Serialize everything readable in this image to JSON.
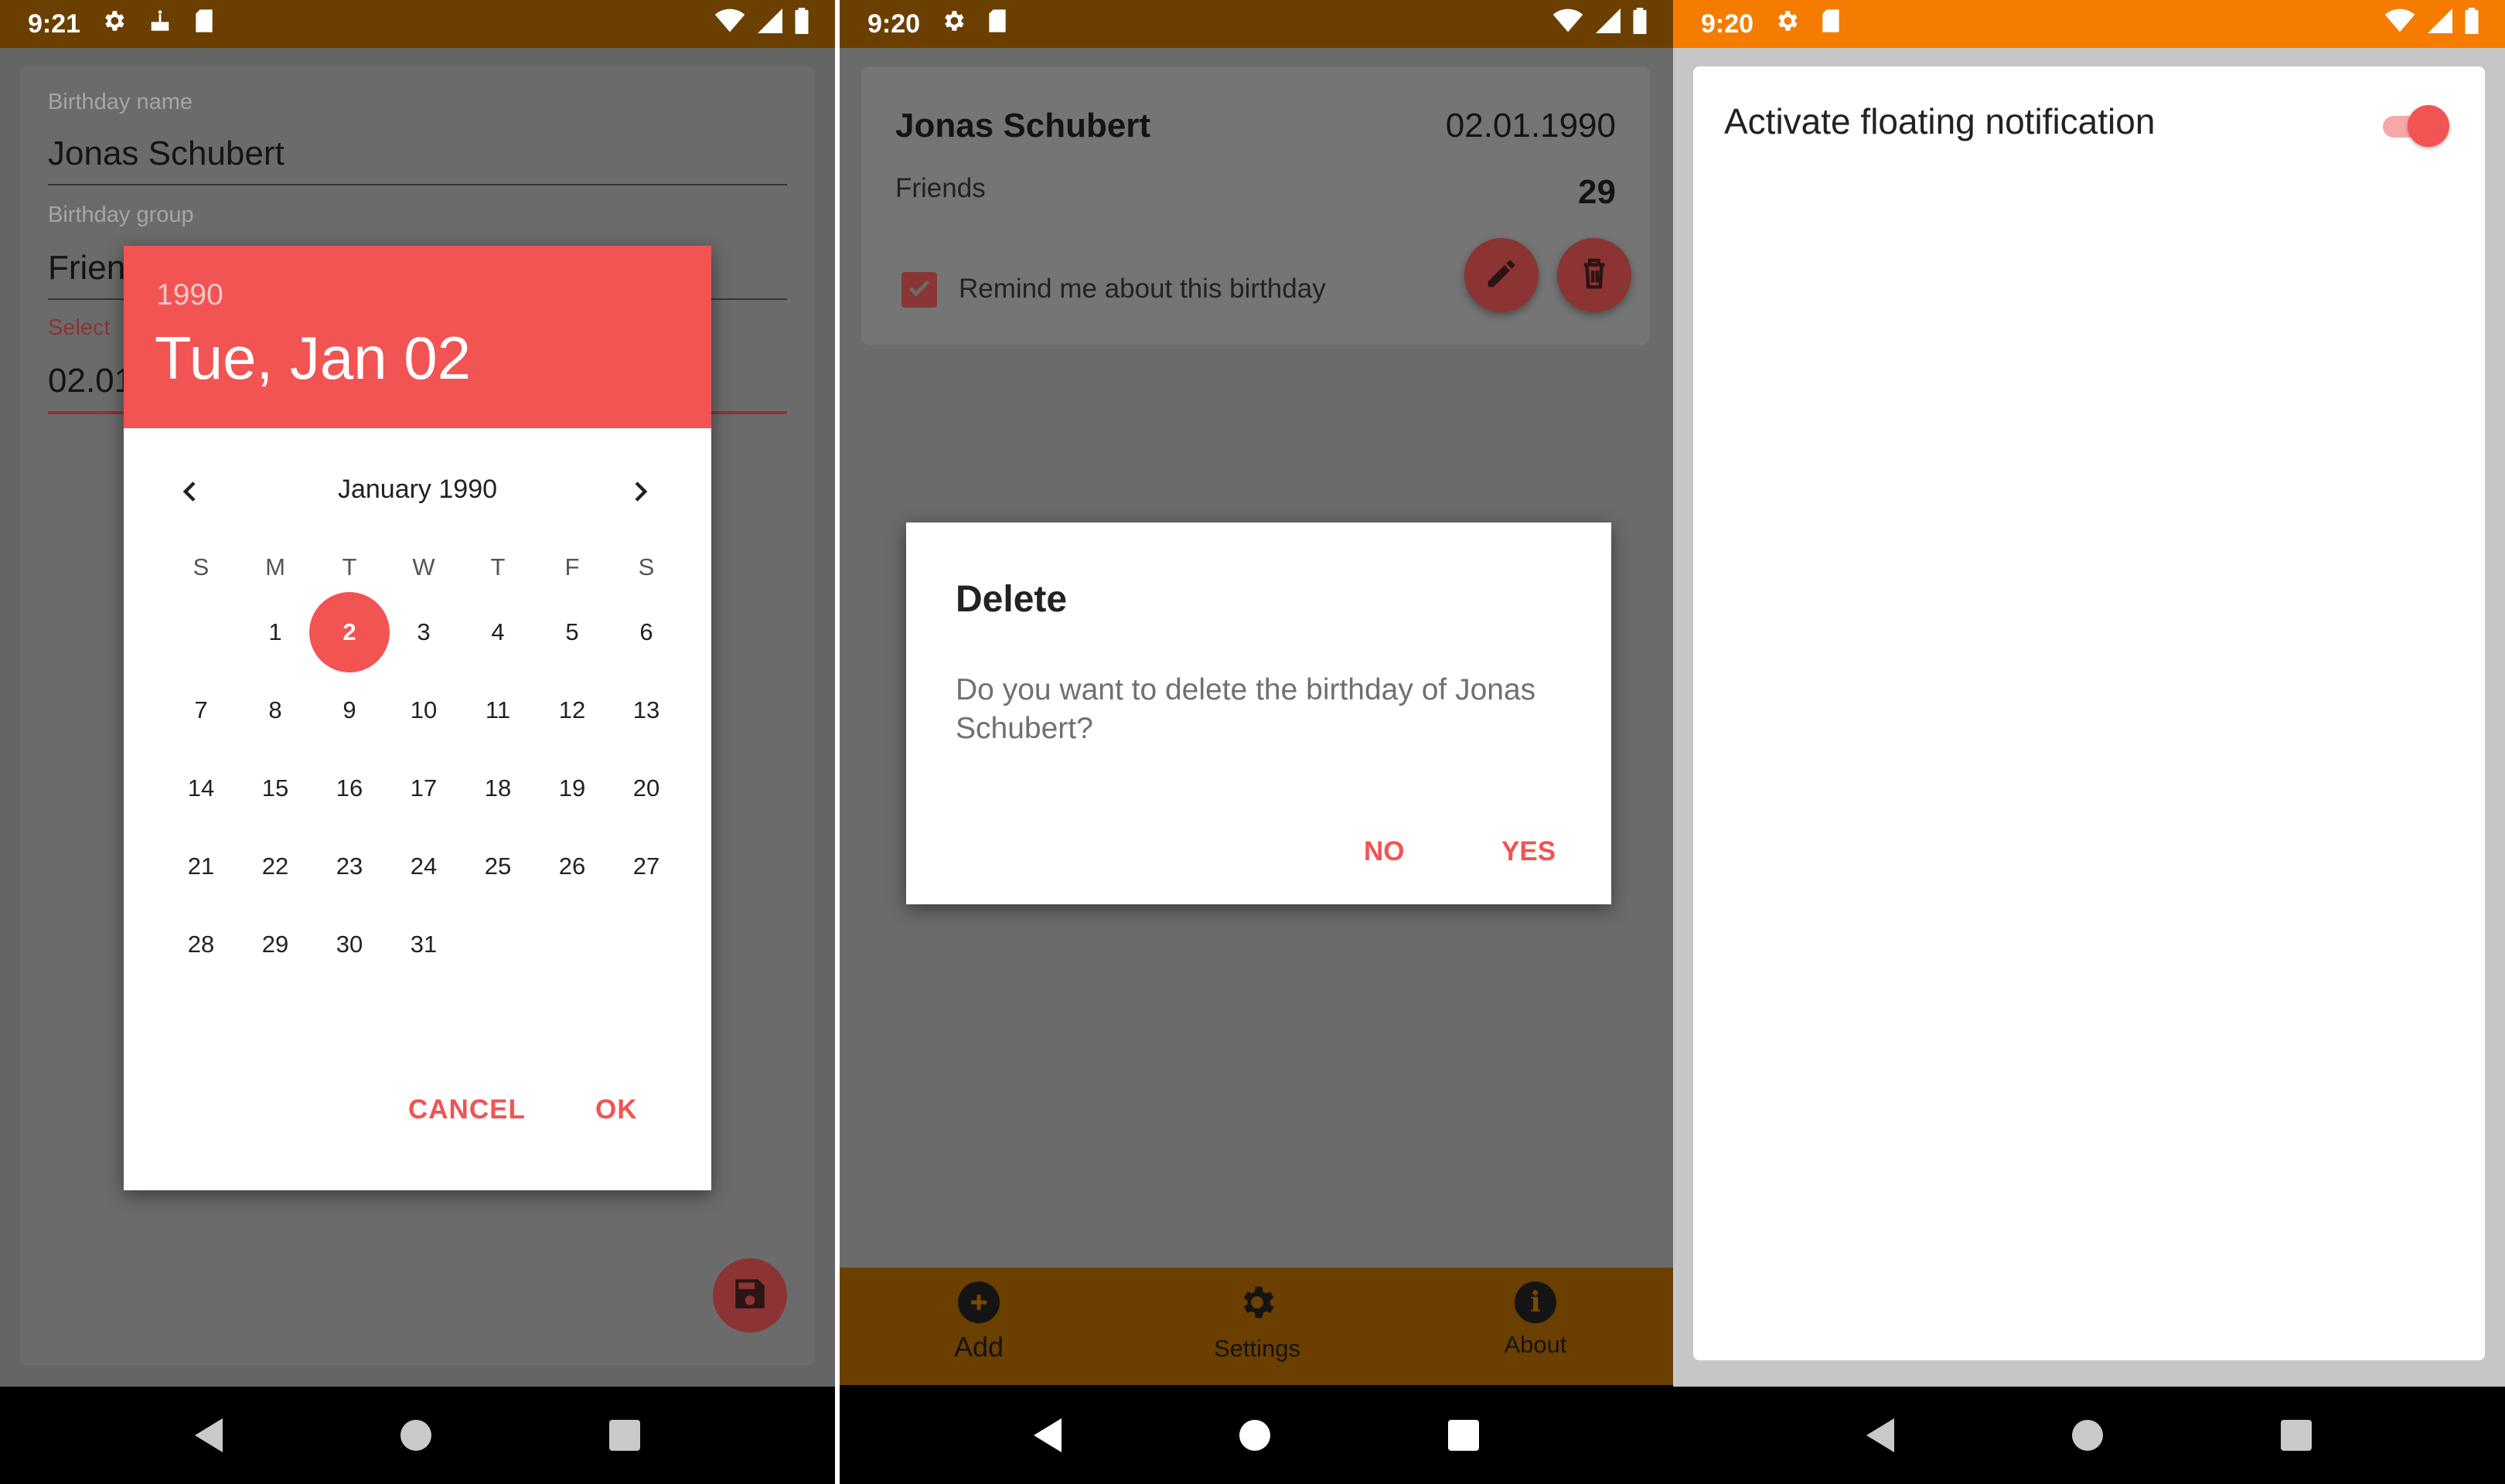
{
  "screen1": {
    "status": {
      "time": "9:21"
    },
    "form": {
      "name_label": "Birthday name",
      "name_value": "Jonas Schubert",
      "group_label": "Birthday group",
      "group_value": "Frien",
      "date_label": "Select",
      "date_value": "02.01"
    },
    "datepicker": {
      "year": "1990",
      "date_title": "Tue, Jan 02",
      "month_title": "January 1990",
      "weekdays": [
        "S",
        "M",
        "T",
        "W",
        "T",
        "F",
        "S"
      ],
      "days": [
        "1",
        "2",
        "3",
        "4",
        "5",
        "6",
        "7",
        "8",
        "9",
        "10",
        "11",
        "12",
        "13",
        "14",
        "15",
        "16",
        "17",
        "18",
        "19",
        "20",
        "21",
        "22",
        "23",
        "24",
        "25",
        "26",
        "27",
        "28",
        "29",
        "30",
        "31"
      ],
      "selected_day": "2",
      "cancel": "CANCEL",
      "ok": "OK"
    }
  },
  "screen2": {
    "status": {
      "time": "9:20"
    },
    "card": {
      "name": "Jonas Schubert",
      "date": "02.01.1990",
      "group": "Friends",
      "age": "29",
      "remind_label": "Remind me about this birthday",
      "remind_checked": true
    },
    "dialog": {
      "title": "Delete",
      "message": "Do you want to delete the birthday of Jonas Schubert?",
      "no": "NO",
      "yes": "YES"
    },
    "bottom_nav": [
      {
        "label": "Add",
        "icon": "add-circle-icon"
      },
      {
        "label": "Settings",
        "icon": "gear-icon"
      },
      {
        "label": "About",
        "icon": "info-icon"
      }
    ]
  },
  "screen3": {
    "status": {
      "time": "9:20"
    },
    "setting": {
      "label": "Activate floating notification",
      "enabled": true
    }
  },
  "colors": {
    "accent": "#f25353",
    "dark_accent": "#8c3434",
    "status_dark": "#6b3f00",
    "status_orange": "#f57c00",
    "dim_background": "#656565"
  }
}
